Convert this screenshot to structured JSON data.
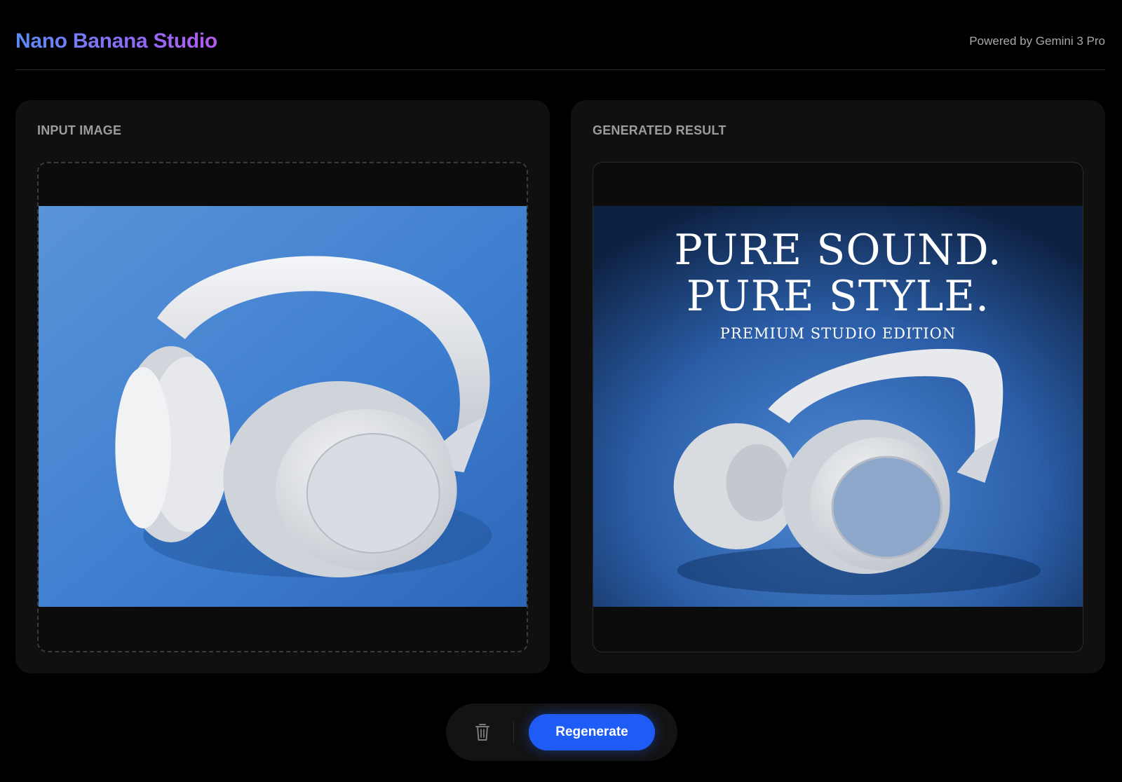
{
  "header": {
    "brand": "Nano Banana Studio",
    "powered_by": "Powered by Gemini 3 Pro"
  },
  "input_panel": {
    "title": "INPUT IMAGE",
    "image": "headphones-photo"
  },
  "result_panel": {
    "title": "GENERATED RESULT",
    "image": "headphones-ad",
    "headline_line1": "PURE SOUND.",
    "headline_line2": "PURE STYLE.",
    "subheadline": "PREMIUM STUDIO EDITION"
  },
  "actions": {
    "delete_icon": "trash-icon",
    "regenerate_label": "Regenerate"
  },
  "colors": {
    "background": "#000000",
    "panel": "#101010",
    "accent": "#1f5cf5",
    "brand_gradient_start": "#5b8cf6",
    "brand_gradient_end": "#b25cf0"
  }
}
